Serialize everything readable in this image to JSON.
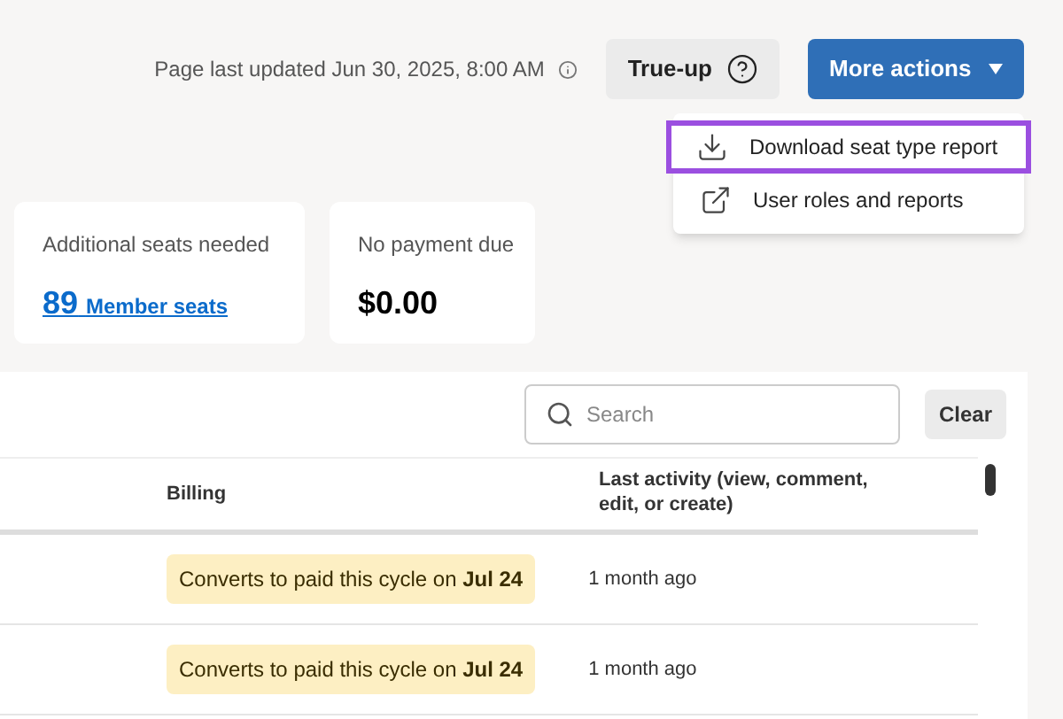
{
  "header": {
    "updated": "Page last updated Jun 30, 2025, 8:00 AM",
    "true_up_button": "True-up",
    "more_actions_button": "More actions"
  },
  "menu": {
    "items": [
      {
        "label": "Download seat type report",
        "kind": "download",
        "selected": true
      },
      {
        "label": "User roles and reports",
        "kind": "external",
        "selected": false
      }
    ]
  },
  "cards": [
    {
      "label": "Additional seats needed",
      "kind": "link",
      "count": "89",
      "value": "Member seats"
    },
    {
      "label": "No payment due",
      "kind": "amount",
      "value": "$0.00"
    }
  ],
  "search": {
    "placeholder": "Search"
  },
  "clear_button": "Clear",
  "table": {
    "columns": [
      "Billing",
      "Last activity (view, comment, edit, or create)"
    ],
    "rows": [
      {
        "billing": "Converts to paid this cycle on **Jul 24**",
        "last_activity": "1 month ago"
      },
      {
        "billing": "Converts to paid this cycle on **Jul 24**",
        "last_activity": "1 month ago"
      }
    ]
  }
}
